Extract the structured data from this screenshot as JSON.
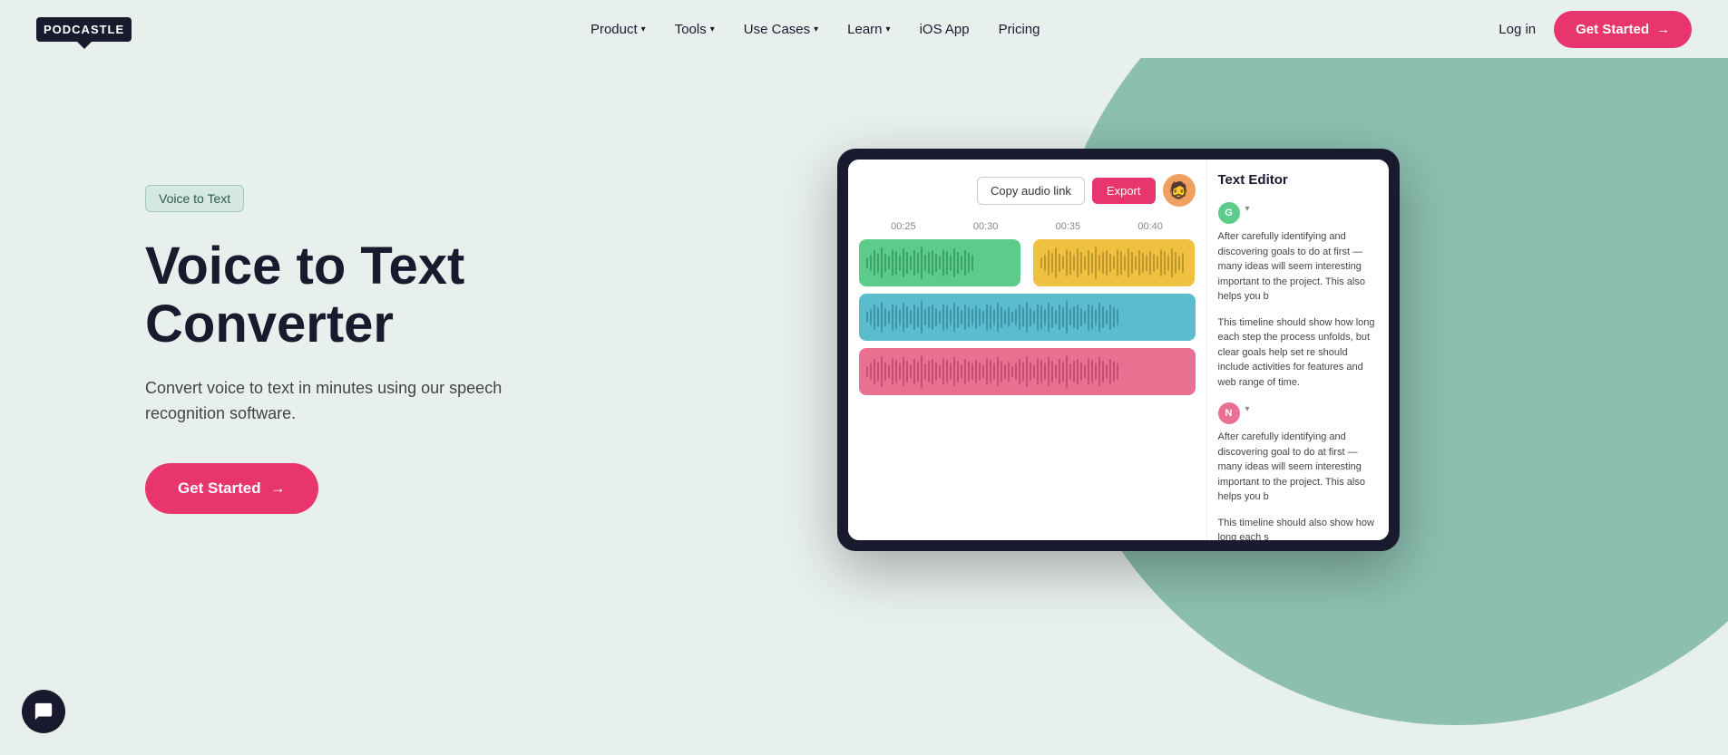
{
  "nav": {
    "logo_text": "PODCASTLE",
    "links": [
      {
        "label": "Product",
        "has_dropdown": true
      },
      {
        "label": "Tools",
        "has_dropdown": true
      },
      {
        "label": "Use Cases",
        "has_dropdown": true
      },
      {
        "label": "Learn",
        "has_dropdown": true
      },
      {
        "label": "iOS App",
        "has_dropdown": false
      },
      {
        "label": "Pricing",
        "has_dropdown": false
      }
    ],
    "login_label": "Log in",
    "cta_label": "Get Started"
  },
  "hero": {
    "badge_text": "Voice to Text",
    "title_line1": "Voice to Text",
    "title_line2": "Converter",
    "subtitle": "Convert voice to text in minutes using our speech recognition software.",
    "cta_label": "Get Started"
  },
  "tablet": {
    "copy_btn": "Copy audio link",
    "export_btn": "Export",
    "timeline_labels": [
      "00:25",
      "00:30",
      "00:35",
      "00:40"
    ],
    "text_editor_title": "Text Editor",
    "speaker_g_text": "After carefully identifying and discovering goals to do at first — many ideas will seem interesting important to the project. This also helps you b",
    "paragraph_1": "This timeline should show how long each step the process unfolds, but clear goals help set re should include activities for features and web range of time.",
    "speaker_n_text": "After carefully identifying and discovering goal to do at first — many ideas will seem interesting important to the project. This also helps you b",
    "paragraph_2": "This timeline should also show how long each s"
  },
  "chat": {
    "icon": "chat-icon"
  }
}
